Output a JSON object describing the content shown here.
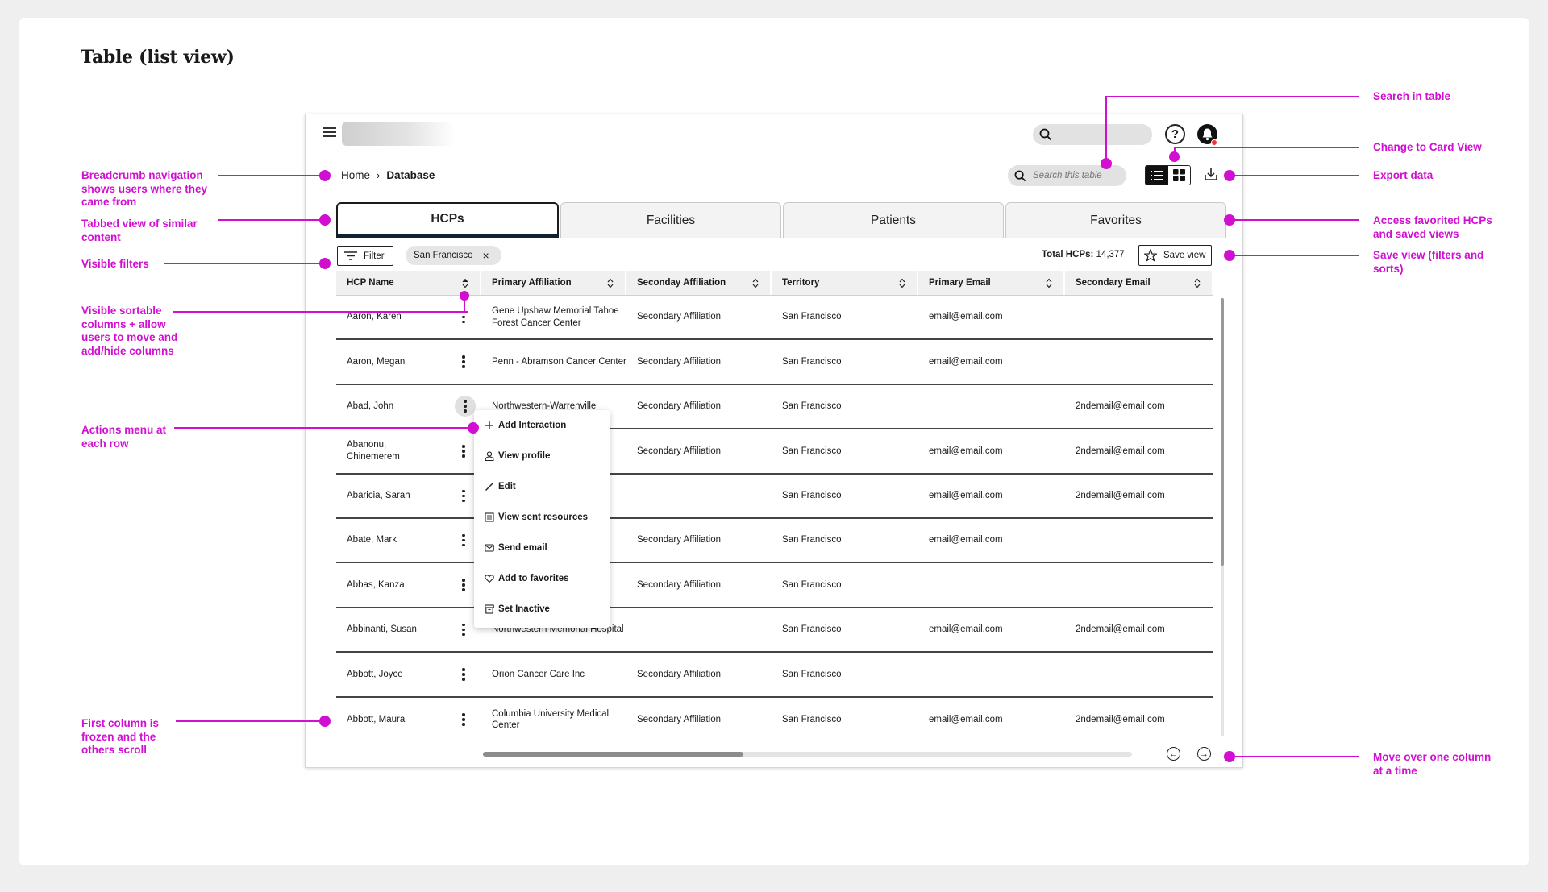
{
  "page_title": "Table (list view)",
  "annotations": {
    "breadcrumb": "Breadcrumb navigation shows users where they came from",
    "tabbed": "Tabbed view of similar content",
    "filters": "Visible filters",
    "sortable": "Visible sortable columns + allow users to move and add/hide columns",
    "actions": "Actions menu at each row",
    "frozen": "First column is frozen and the others scroll",
    "search": "Search in table",
    "card_view": "Change to Card View",
    "export": "Export data",
    "favorites": "Access favorited HCPs and saved views",
    "save_view": "Save view (filters and sorts)",
    "move_column": "Move over one column at a time"
  },
  "header": {
    "search_placeholder": "",
    "help_label": "?"
  },
  "breadcrumb": {
    "home": "Home",
    "current": "Database"
  },
  "table_search": {
    "placeholder": "Search this table"
  },
  "tabs": [
    {
      "label": "HCPs",
      "active": true
    },
    {
      "label": "Facilities",
      "active": false
    },
    {
      "label": "Patients",
      "active": false
    },
    {
      "label": "Favorites",
      "active": false
    }
  ],
  "filter": {
    "button_label": "Filter",
    "chip_label": "San Francisco",
    "chip_close": "×"
  },
  "total": {
    "label": "Total HCPs:",
    "value": "14,377"
  },
  "save_view_label": "Save view",
  "columns": [
    "HCP Name",
    "Primary Affiliation",
    "Seconday Affiliation",
    "Territory",
    "Primary Email",
    "Secondary Email"
  ],
  "rows": [
    [
      "Aaron, Karen",
      "Gene Upshaw Memorial Tahoe Forest Cancer Center",
      "Secondary Affiliation",
      "San Francisco",
      "email@email.com",
      ""
    ],
    [
      "Aaron, Megan",
      "Penn - Abramson Cancer Center",
      "Secondary Affiliation",
      "San Francisco",
      "email@email.com",
      ""
    ],
    [
      "Abad, John",
      "Northwestern-Warrenville",
      "Secondary Affiliation",
      "San Francisco",
      "",
      "2ndemail@email.com"
    ],
    [
      "Abanonu, Chinemerem",
      "",
      "Secondary Affiliation",
      "San Francisco",
      "email@email.com",
      "2ndemail@email.com"
    ],
    [
      "Abaricia, Sarah",
      "",
      "",
      "San Francisco",
      "email@email.com",
      "2ndemail@email.com"
    ],
    [
      "Abate, Mark",
      "",
      "Secondary Affiliation",
      "San Francisco",
      "email@email.com",
      ""
    ],
    [
      "Abbas, Kanza",
      "",
      "Secondary Affiliation",
      "San Francisco",
      "",
      ""
    ],
    [
      "Abbinanti, Susan",
      "Northwestern Memorial Hospital",
      "",
      "San Francisco",
      "email@email.com",
      "2ndemail@email.com"
    ],
    [
      "Abbott, Joyce",
      "Orion Cancer Care Inc",
      "Secondary Affiliation",
      "San Francisco",
      "",
      ""
    ],
    [
      "Abbott, Maura",
      "Columbia University Medical Center",
      "Secondary Affiliation",
      "San Francisco",
      "email@email.com",
      "2ndemail@email.com"
    ]
  ],
  "actions_menu": [
    {
      "label": "Add Interaction",
      "icon": "plus-icon"
    },
    {
      "label": "View profile",
      "icon": "person-icon"
    },
    {
      "label": "Edit",
      "icon": "pencil-icon"
    },
    {
      "label": "View sent resources",
      "icon": "document-icon"
    },
    {
      "label": "Send email",
      "icon": "mail-icon"
    },
    {
      "label": "Add to favorites",
      "icon": "heart-icon"
    },
    {
      "label": "Set Inactive",
      "icon": "archive-icon"
    }
  ],
  "colors": {
    "annotation": "#d10fd1",
    "tab_active_border": "#0f2233"
  }
}
